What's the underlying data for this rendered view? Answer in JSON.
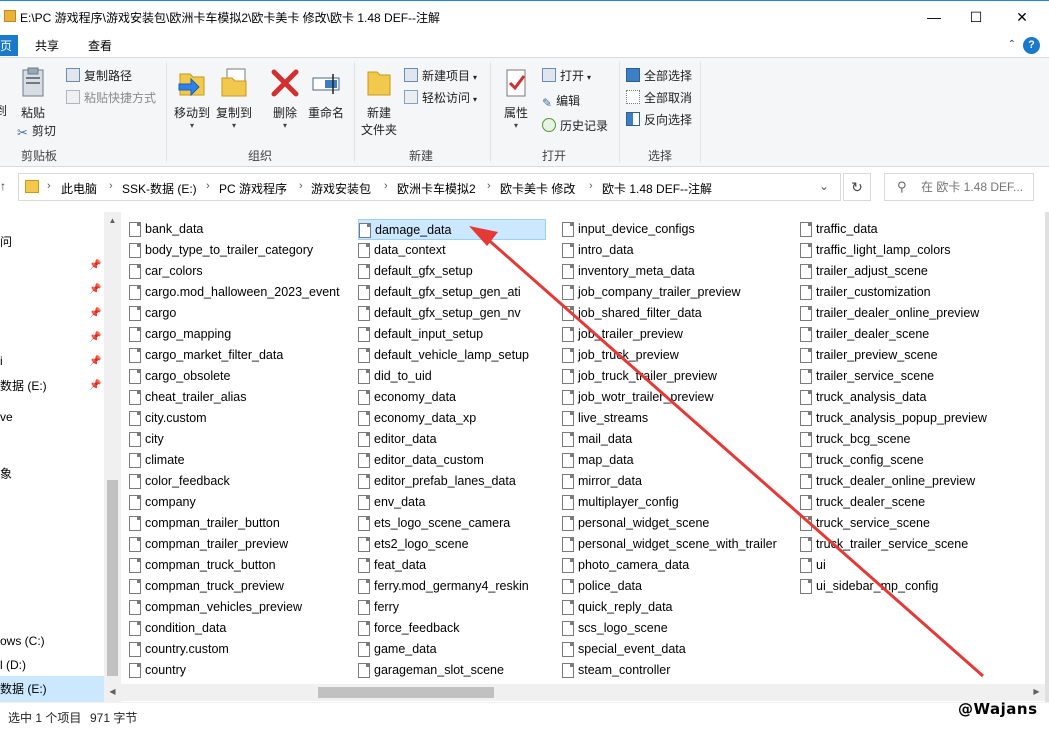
{
  "window": {
    "title": "E:\\PC 游戏程序\\游戏安装包\\欧洲卡车模拟2\\欧卡美卡 修改\\欧卡 1.48 DEF--注解",
    "minimize": "—",
    "maximize": "☐",
    "close": "✕"
  },
  "ribbon_tabs": [
    "页",
    "共享",
    "查看"
  ],
  "help_label": "?",
  "collapse_label": "⌃",
  "ribbon": {
    "clipboard": {
      "pin_label": "到",
      "paste": "粘贴",
      "copy_path": "复制路径",
      "paste_shortcut": "粘贴快捷方式",
      "cut": "剪切",
      "group": "剪贴板"
    },
    "organize": {
      "move_to": "移动到",
      "copy_to": "复制到",
      "delete": "删除",
      "rename": "重命名",
      "group": "组织"
    },
    "new": {
      "new_folder": "新建\n文件夹",
      "new_folder_l1": "新建",
      "new_folder_l2": "文件夹",
      "new_item": "新建项目",
      "easy_access": "轻松访问",
      "group": "新建"
    },
    "open": {
      "properties": "属性",
      "open": "打开",
      "edit": "编辑",
      "history": "历史记录",
      "group": "打开"
    },
    "select": {
      "select_all": "全部选择",
      "select_none": "全部取消",
      "invert": "反向选择",
      "group": "选择"
    }
  },
  "address": {
    "crumbs": [
      "此电脑",
      "SSK-数据 (E:)",
      "PC 游戏程序",
      "游戏安装包",
      "欧洲卡车模拟2",
      "欧卡美卡 修改",
      "欧卡 1.48 DEF--注解"
    ],
    "search_placeholder": "在 欧卡 1.48 DEF..."
  },
  "nav": {
    "items": [
      "问",
      "",
      "",
      "",
      "",
      "",
      "数据 (E:)",
      "ve",
      "",
      "象",
      "ows (C:)",
      "l (D:)",
      "数据 (E:)"
    ]
  },
  "files": {
    "col1": [
      "bank_data",
      "body_type_to_trailer_category",
      "car_colors",
      "cargo.mod_halloween_2023_event",
      "cargo",
      "cargo_mapping",
      "cargo_market_filter_data",
      "cargo_obsolete",
      "cheat_trailer_alias",
      "city.custom",
      "city",
      "climate",
      "color_feedback",
      "company",
      "compman_trailer_button",
      "compman_trailer_preview",
      "compman_truck_button",
      "compman_truck_preview",
      "compman_vehicles_preview",
      "condition_data",
      "country.custom",
      "country"
    ],
    "col2": [
      "damage_data",
      "data_context",
      "default_gfx_setup",
      "default_gfx_setup_gen_ati",
      "default_gfx_setup_gen_nv",
      "default_input_setup",
      "default_vehicle_lamp_setup",
      "did_to_uid",
      "economy_data",
      "economy_data_xp",
      "editor_data",
      "editor_data_custom",
      "editor_prefab_lanes_data",
      "env_data",
      "ets_logo_scene_camera",
      "ets2_logo_scene",
      "feat_data",
      "ferry.mod_germany4_reskin",
      "ferry",
      "force_feedback",
      "game_data",
      "garageman_slot_scene"
    ],
    "col3": [
      "input_device_configs",
      "intro_data",
      "inventory_meta_data",
      "job_company_trailer_preview",
      "job_shared_filter_data",
      "job_trailer_preview",
      "job_truck_preview",
      "job_truck_trailer_preview",
      "job_wotr_trailer_preview",
      "live_streams",
      "mail_data",
      "map_data",
      "mirror_data",
      "multiplayer_config",
      "personal_widget_scene",
      "personal_widget_scene_with_trailer",
      "photo_camera_data",
      "police_data",
      "quick_reply_data",
      "scs_logo_scene",
      "special_event_data",
      "steam_controller"
    ],
    "col4": [
      "traffic_data",
      "traffic_light_lamp_colors",
      "trailer_adjust_scene",
      "trailer_customization",
      "trailer_dealer_online_preview",
      "trailer_dealer_scene",
      "trailer_preview_scene",
      "trailer_service_scene",
      "truck_analysis_data",
      "truck_analysis_popup_preview",
      "truck_bcg_scene",
      "truck_config_scene",
      "truck_dealer_online_preview",
      "truck_dealer_scene",
      "truck_service_scene",
      "truck_trailer_service_scene",
      "ui",
      "ui_sidebar_mp_config"
    ]
  },
  "status": {
    "selected": "选中 1 个项目",
    "size": "971 字节"
  },
  "watermark": "@Wajans",
  "colors": {
    "accent": "#1979ca",
    "selection": "#cce8ff",
    "annotation_arrow": "#e53935"
  }
}
